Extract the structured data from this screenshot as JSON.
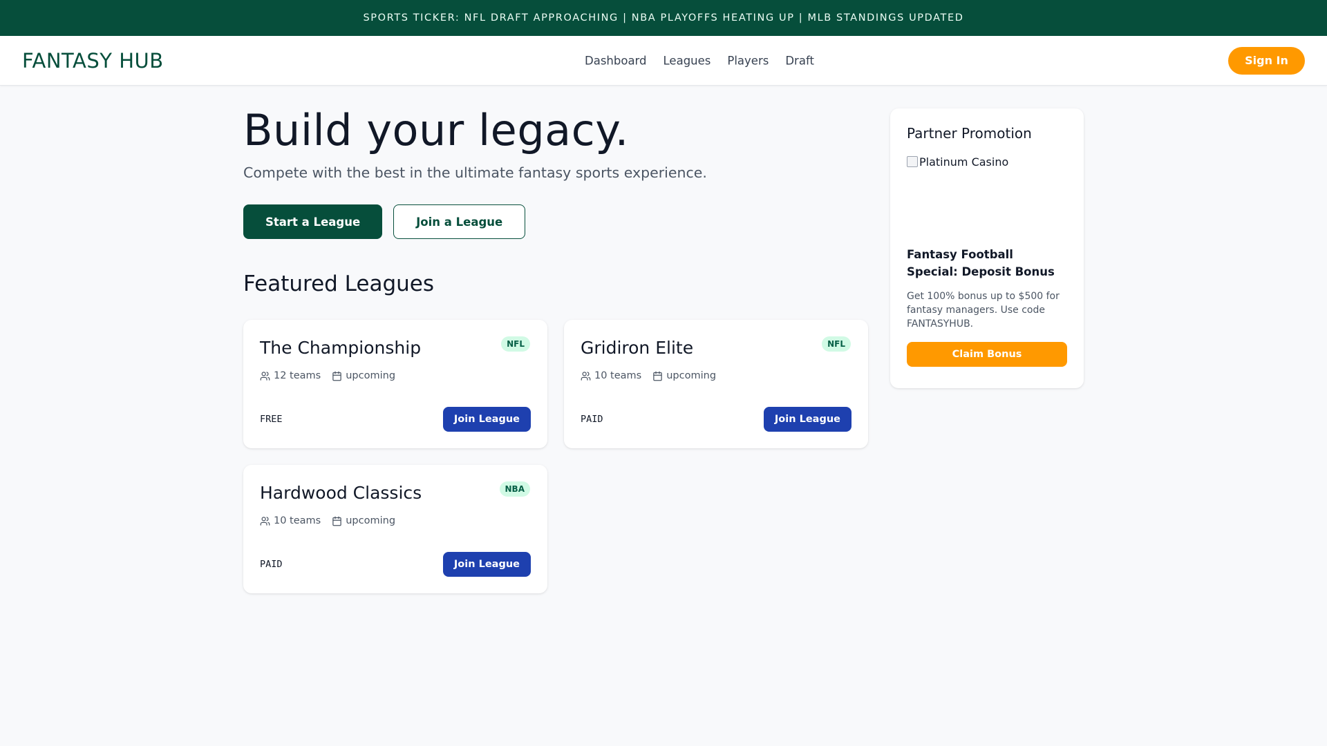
{
  "ticker": {
    "text": "SPORTS TICKER: NFL DRAFT APPROACHING | NBA PLAYOFFS HEATING UP | MLB STANDINGS UPDATED"
  },
  "nav": {
    "logo": "FANTASY HUB",
    "links": [
      "Dashboard",
      "Leagues",
      "Players",
      "Draft"
    ],
    "signin_label": "Sign In"
  },
  "hero": {
    "title": "Build your legacy.",
    "subtitle": "Compete with the best in the ultimate fantasy sports experience.",
    "primary_label": "Start a League",
    "secondary_label": "Join a League"
  },
  "featured": {
    "title": "Featured Leagues",
    "leagues": [
      {
        "name": "The Championship",
        "sport": "NFL",
        "teams": "12 teams",
        "status": "upcoming",
        "price": "FREE",
        "button": "Join League"
      },
      {
        "name": "Gridiron Elite",
        "sport": "NFL",
        "teams": "10 teams",
        "status": "upcoming",
        "price": "PAID",
        "button": "Join League"
      },
      {
        "name": "Hardwood Classics",
        "sport": "NBA",
        "teams": "10 teams",
        "status": "upcoming",
        "price": "PAID",
        "button": "Join League"
      }
    ]
  },
  "promo": {
    "title": "Partner Promotion",
    "image_alt": "Platinum Casino",
    "headline": "Fantasy Football Special: Deposit Bonus",
    "body": "Get 100% bonus up to $500 for fantasy managers. Use code FANTASYHUB.",
    "button": "Claim Bonus"
  },
  "colors": {
    "brand": "#064e3b",
    "accent": "#ff9900",
    "join_button": "#1e40af",
    "badge_bg": "#d1fae5"
  },
  "icons": {
    "teams": "users-icon",
    "status": "calendar-icon",
    "promo_image": "broken-image-icon"
  }
}
